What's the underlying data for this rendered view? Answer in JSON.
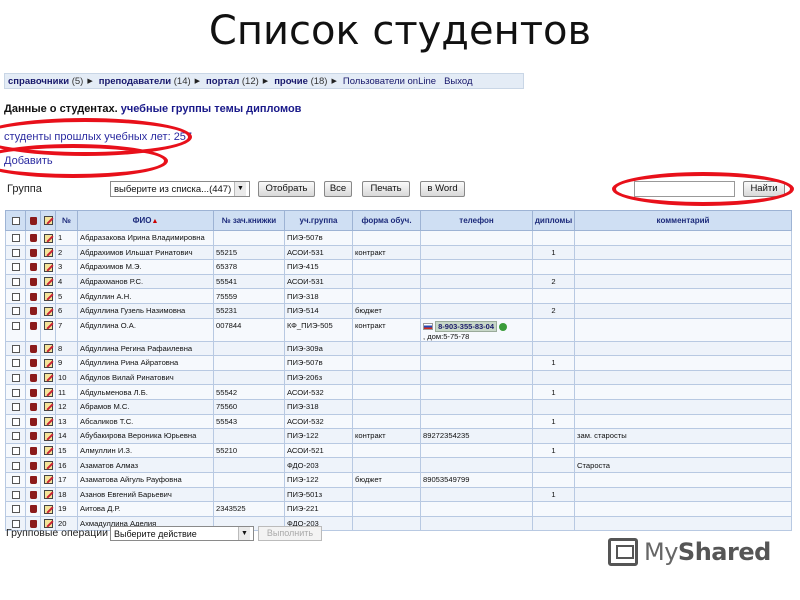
{
  "slide": {
    "title": "Список студентов"
  },
  "topnav": {
    "items": [
      {
        "label": "справочники",
        "count": "(5)"
      },
      {
        "label": "преподаватели",
        "count": "(14)"
      },
      {
        "label": "портал",
        "count": "(12)"
      },
      {
        "label": "прочие",
        "count": "(18)"
      }
    ],
    "online_users": "Пользователи onLine",
    "exit": "Выход"
  },
  "subnav": {
    "prefix": "Данные о студентах.",
    "groups": "учебные группы",
    "topics": "темы дипломов"
  },
  "links": {
    "previous_years": "студенты прошлых учебных лет: 257",
    "add": "Добавить"
  },
  "filter": {
    "group_label": "Группа",
    "group_select": "выберите из списка...(447)",
    "select_button": "Отобрать",
    "all_button": "Все",
    "print_button": "Печать",
    "word_button": "в Word",
    "find_button": "Найти",
    "search_value": ""
  },
  "table": {
    "headers": [
      "№",
      "ФИО",
      "№ зач.книжки",
      "уч.группа",
      "форма обуч.",
      "телефон",
      "дипломы",
      "комментарий"
    ],
    "rows": [
      {
        "n": "1",
        "name": "Абдразакова Ирина Владимировна",
        "book": "",
        "group": "ПИЭ-507в",
        "form": "",
        "phone": "",
        "diplomas": "",
        "comment": ""
      },
      {
        "n": "2",
        "name": "Абдрахимов Ильшат Ринатович",
        "book": "55215",
        "group": "АСОИ-531",
        "form": "контракт",
        "phone": "",
        "diplomas": "1",
        "comment": ""
      },
      {
        "n": "3",
        "name": "Абдрахимов М.Э.",
        "book": "65378",
        "group": "ПИЭ-415",
        "form": "",
        "phone": "",
        "diplomas": "",
        "comment": ""
      },
      {
        "n": "4",
        "name": "Абдрахманов Р.С.",
        "book": "55541",
        "group": "АСОИ-531",
        "form": "",
        "phone": "",
        "diplomas": "2",
        "comment": ""
      },
      {
        "n": "5",
        "name": "Абдуллин А.Н.",
        "book": "75559",
        "group": "ПИЭ-318",
        "form": "",
        "phone": "",
        "diplomas": "",
        "comment": ""
      },
      {
        "n": "6",
        "name": "Абдуллина Гузель Назимовна",
        "book": "55231",
        "group": "ПИЭ-514",
        "form": "бюджет",
        "phone": "",
        "diplomas": "2",
        "comment": ""
      },
      {
        "n": "7",
        "name": "Абдуллина О.А.",
        "book": "007844",
        "group": "КФ_ПИЭ-505",
        "form": "контракт",
        "phone": "8-903-355-83-04",
        "phone_extra": ", дом:5-75-78",
        "diplomas": "",
        "comment": ""
      },
      {
        "n": "8",
        "name": "Абдуллина Регина Рафаилевна",
        "book": "",
        "group": "ПИЭ-309а",
        "form": "",
        "phone": "",
        "diplomas": "",
        "comment": ""
      },
      {
        "n": "9",
        "name": "Абдуллина Рина Айратовна",
        "book": "",
        "group": "ПИЭ-507в",
        "form": "",
        "phone": "",
        "diplomas": "1",
        "comment": ""
      },
      {
        "n": "10",
        "name": "Абдулов Вилай Ринатович",
        "book": "",
        "group": "ПИЭ-206з",
        "form": "",
        "phone": "",
        "diplomas": "",
        "comment": ""
      },
      {
        "n": "11",
        "name": "Абдульменова Л.Б.",
        "book": "55542",
        "group": "АСОИ-532",
        "form": "",
        "phone": "",
        "diplomas": "1",
        "comment": ""
      },
      {
        "n": "12",
        "name": "Абрамов М.С.",
        "book": "75560",
        "group": "ПИЭ-318",
        "form": "",
        "phone": "",
        "diplomas": "",
        "comment": ""
      },
      {
        "n": "13",
        "name": "Абсаликов Т.С.",
        "book": "55543",
        "group": "АСОИ-532",
        "form": "",
        "phone": "",
        "diplomas": "1",
        "comment": ""
      },
      {
        "n": "14",
        "name": "Абубакирова Вероника Юрьевна",
        "book": "",
        "group": "ПИЭ-122",
        "form": "контракт",
        "phone": "89272354235",
        "diplomas": "",
        "comment": "зам. старосты"
      },
      {
        "n": "15",
        "name": "Алмуллин И.З.",
        "book": "55210",
        "group": "АСОИ-521",
        "form": "",
        "phone": "",
        "diplomas": "1",
        "comment": ""
      },
      {
        "n": "16",
        "name": "Азаматов Алмаз",
        "book": "",
        "group": "ФДО-203",
        "form": "",
        "phone": "",
        "diplomas": "",
        "comment": "Староста"
      },
      {
        "n": "17",
        "name": "Азаматова Айгуль Рауфовна",
        "book": "",
        "group": "ПИЭ-122",
        "form": "бюджет",
        "phone": "89053549799",
        "diplomas": "",
        "comment": ""
      },
      {
        "n": "18",
        "name": "Азанов Евгений Барьевич",
        "book": "",
        "group": "ПИЭ-501з",
        "form": "",
        "phone": "",
        "diplomas": "1",
        "comment": ""
      },
      {
        "n": "19",
        "name": "Аитова Д.Р.",
        "book": "2343525",
        "group": "ПИЭ-221",
        "form": "",
        "phone": "",
        "diplomas": "",
        "comment": ""
      },
      {
        "n": "20",
        "name": "Ахмадуллина Аделия",
        "book": "",
        "group": "ФДО-203",
        "form": "",
        "phone": "",
        "diplomas": "",
        "comment": ""
      }
    ]
  },
  "bulk": {
    "label": "Групповые операции",
    "select": "Выберите действие",
    "execute": "Выполнить"
  },
  "watermark": {
    "text_light": "My",
    "text_bold": "Shared"
  },
  "colors": {
    "highlight": "#e8101a",
    "header_bg": "#cfdff3"
  }
}
